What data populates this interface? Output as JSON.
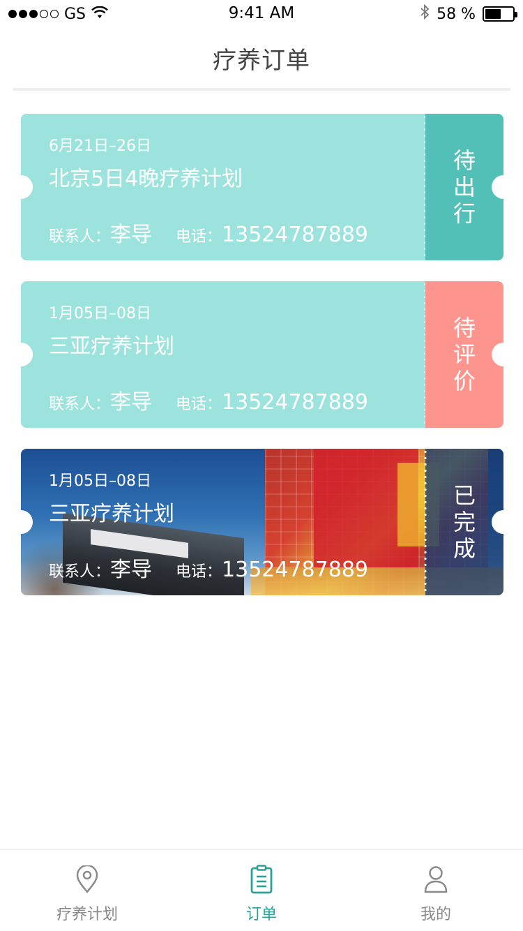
{
  "status_bar": {
    "carrier": "GS",
    "time": "9:41 AM",
    "battery_text": "58 %",
    "battery_level": 0.58
  },
  "nav": {
    "title": "疗养订单"
  },
  "orders": [
    {
      "date": "6月21日–26日",
      "title": "北京5日4晚疗养计划",
      "contact_label": "联系人：",
      "contact_name": "李导",
      "phone_label": "电话：",
      "phone": "13524787889",
      "status": "待出行",
      "status_color": "#52c0b7"
    },
    {
      "date": "1月05日–08日",
      "title": "三亚疗养计划",
      "contact_label": "联系人：",
      "contact_name": "李导",
      "phone_label": "电话：",
      "phone": "13524787889",
      "status": "待评价",
      "status_color": "#fe948e"
    },
    {
      "date": "1月05日–08日",
      "title": "三亚疗养计划",
      "contact_label": "联系人：",
      "contact_name": "李导",
      "phone_label": "电话：",
      "phone": "13524787889",
      "status": "已完成",
      "status_color": "#1f4a85"
    }
  ],
  "tabs": [
    {
      "label": "疗养计划",
      "icon": "location-pin-icon",
      "active": false
    },
    {
      "label": "订单",
      "icon": "clipboard-icon",
      "active": true
    },
    {
      "label": "我的",
      "icon": "user-icon",
      "active": false
    }
  ],
  "colors": {
    "accent": "#2aa198",
    "card_bg": "#9ce3dd",
    "inactive": "#888888"
  }
}
